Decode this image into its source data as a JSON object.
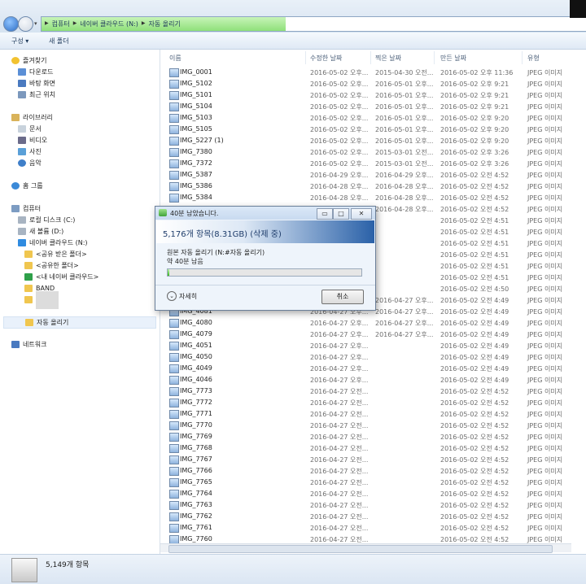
{
  "address": {
    "crumbs": [
      "컴퓨터",
      "네이버 클라우드 (N:)",
      "자동 올리기"
    ]
  },
  "toolbar": {
    "organize": "구성 ▾",
    "new_folder": "새 폴더"
  },
  "nav": {
    "favorites": "즐겨찾기",
    "downloads": "다운로드",
    "desktop": "바탕 화면",
    "recent": "최근 위치",
    "libraries": "라이브러리",
    "documents": "문서",
    "videos": "비디오",
    "pictures": "사진",
    "music": "음악",
    "homegroup": "홈 그룹",
    "computer": "컴퓨터",
    "local_disk": "로컬 디스크 (C:)",
    "new_volume": "새 볼륨 (D:)",
    "naver_cloud": "네이버 클라우드 (N:)",
    "shared_received": "<공유 받은 폴더>",
    "shared_folder": "<공유한 폴더>",
    "my_cloud": "<내 네이버 클라우드>",
    "band": "BAND",
    "auto_upload": "자동 올리기",
    "network": "네트워크"
  },
  "columns": [
    "이름",
    "수정한 날짜",
    "찍은 날짜",
    "만든 날짜",
    "유형"
  ],
  "files": [
    {
      "name": "IMG_0001",
      "modified": "2016-05-02 오후...",
      "taken": "2015-04-30 오전...",
      "created": "2016-05-02 오후 11:36",
      "type": "JPEG 이미지"
    },
    {
      "name": "IMG_5102",
      "modified": "2016-05-02 오후...",
      "taken": "2016-05-01 오후...",
      "created": "2016-05-02 오후 9:21",
      "type": "JPEG 이미지"
    },
    {
      "name": "IMG_5101",
      "modified": "2016-05-02 오후...",
      "taken": "2016-05-01 오후...",
      "created": "2016-05-02 오후 9:21",
      "type": "JPEG 이미지"
    },
    {
      "name": "IMG_5104",
      "modified": "2016-05-02 오후...",
      "taken": "2016-05-01 오후...",
      "created": "2016-05-02 오후 9:21",
      "type": "JPEG 이미지"
    },
    {
      "name": "IMG_5103",
      "modified": "2016-05-02 오후...",
      "taken": "2016-05-01 오후...",
      "created": "2016-05-02 오후 9:20",
      "type": "JPEG 이미지"
    },
    {
      "name": "IMG_5105",
      "modified": "2016-05-02 오후...",
      "taken": "2016-05-01 오후...",
      "created": "2016-05-02 오후 9:20",
      "type": "JPEG 이미지"
    },
    {
      "name": "IMG_5227 (1)",
      "modified": "2016-05-02 오후...",
      "taken": "2016-05-01 오후...",
      "created": "2016-05-02 오후 9:20",
      "type": "JPEG 이미지"
    },
    {
      "name": "IMG_7380",
      "modified": "2016-05-02 오후...",
      "taken": "2015-03-01 오전...",
      "created": "2016-05-02 오후 3:26",
      "type": "JPEG 이미지"
    },
    {
      "name": "IMG_7372",
      "modified": "2016-05-02 오후...",
      "taken": "2015-03-01 오전...",
      "created": "2016-05-02 오후 3:26",
      "type": "JPEG 이미지"
    },
    {
      "name": "IMG_5387",
      "modified": "2016-04-29 오후...",
      "taken": "2016-04-29 오후...",
      "created": "2016-05-02 오전 4:52",
      "type": "JPEG 이미지"
    },
    {
      "name": "IMG_5386",
      "modified": "2016-04-28 오후...",
      "taken": "2016-04-28 오후...",
      "created": "2016-05-02 오전 4:52",
      "type": "JPEG 이미지"
    },
    {
      "name": "IMG_5384",
      "modified": "2016-04-28 오후...",
      "taken": "2016-04-28 오후...",
      "created": "2016-05-02 오전 4:52",
      "type": "JPEG 이미지"
    },
    {
      "name": "",
      "modified": "",
      "taken": "2016-04-28 오후...",
      "created": "2016-05-02 오전 4:52",
      "type": "JPEG 이미지"
    },
    {
      "name": "",
      "modified": "",
      "taken": "",
      "created": "2016-05-02 오전 4:51",
      "type": "JPEG 이미지"
    },
    {
      "name": "",
      "modified": "",
      "taken": "",
      "created": "2016-05-02 오전 4:51",
      "type": "JPEG 이미지"
    },
    {
      "name": "",
      "modified": "",
      "taken": "",
      "created": "2016-05-02 오전 4:51",
      "type": "JPEG 이미지"
    },
    {
      "name": "",
      "modified": "",
      "taken": "",
      "created": "2016-05-02 오전 4:51",
      "type": "JPEG 이미지"
    },
    {
      "name": "",
      "modified": "",
      "taken": "",
      "created": "2016-05-02 오전 4:51",
      "type": "JPEG 이미지"
    },
    {
      "name": "",
      "modified": "",
      "taken": "",
      "created": "2016-05-02 오전 4:51",
      "type": "JPEG 이미지"
    },
    {
      "name": "",
      "modified": "",
      "taken": "",
      "created": "2016-05-02 오전 4:50",
      "type": "JPEG 이미지"
    },
    {
      "name": "",
      "modified": "",
      "taken": "2016-04-27 오후...",
      "created": "2016-05-02 오전 4:49",
      "type": "JPEG 이미지"
    },
    {
      "name": "IMG_4081",
      "modified": "2016-04-27 오후...",
      "taken": "2016-04-27 오후...",
      "created": "2016-05-02 오전 4:49",
      "type": "JPEG 이미지"
    },
    {
      "name": "IMG_4080",
      "modified": "2016-04-27 오후...",
      "taken": "2016-04-27 오후...",
      "created": "2016-05-02 오전 4:49",
      "type": "JPEG 이미지"
    },
    {
      "name": "IMG_4079",
      "modified": "2016-04-27 오후...",
      "taken": "2016-04-27 오후...",
      "created": "2016-05-02 오전 4:49",
      "type": "JPEG 이미지"
    },
    {
      "name": "IMG_4051",
      "modified": "2016-04-27 오후...",
      "taken": "",
      "created": "2016-05-02 오전 4:49",
      "type": "JPEG 이미지"
    },
    {
      "name": "IMG_4050",
      "modified": "2016-04-27 오후...",
      "taken": "",
      "created": "2016-05-02 오전 4:49",
      "type": "JPEG 이미지"
    },
    {
      "name": "IMG_4049",
      "modified": "2016-04-27 오후...",
      "taken": "",
      "created": "2016-05-02 오전 4:49",
      "type": "JPEG 이미지"
    },
    {
      "name": "IMG_4046",
      "modified": "2016-04-27 오후...",
      "taken": "",
      "created": "2016-05-02 오전 4:49",
      "type": "JPEG 이미지"
    },
    {
      "name": "IMG_7773",
      "modified": "2016-04-27 오전...",
      "taken": "",
      "created": "2016-05-02 오전 4:52",
      "type": "JPEG 이미지"
    },
    {
      "name": "IMG_7772",
      "modified": "2016-04-27 오전...",
      "taken": "",
      "created": "2016-05-02 오전 4:52",
      "type": "JPEG 이미지"
    },
    {
      "name": "IMG_7771",
      "modified": "2016-04-27 오전...",
      "taken": "",
      "created": "2016-05-02 오전 4:52",
      "type": "JPEG 이미지"
    },
    {
      "name": "IMG_7770",
      "modified": "2016-04-27 오전...",
      "taken": "",
      "created": "2016-05-02 오전 4:52",
      "type": "JPEG 이미지"
    },
    {
      "name": "IMG_7769",
      "modified": "2016-04-27 오전...",
      "taken": "",
      "created": "2016-05-02 오전 4:52",
      "type": "JPEG 이미지"
    },
    {
      "name": "IMG_7768",
      "modified": "2016-04-27 오전...",
      "taken": "",
      "created": "2016-05-02 오전 4:52",
      "type": "JPEG 이미지"
    },
    {
      "name": "IMG_7767",
      "modified": "2016-04-27 오전...",
      "taken": "",
      "created": "2016-05-02 오전 4:52",
      "type": "JPEG 이미지"
    },
    {
      "name": "IMG_7766",
      "modified": "2016-04-27 오전...",
      "taken": "",
      "created": "2016-05-02 오전 4:52",
      "type": "JPEG 이미지"
    },
    {
      "name": "IMG_7765",
      "modified": "2016-04-27 오전...",
      "taken": "",
      "created": "2016-05-02 오전 4:52",
      "type": "JPEG 이미지"
    },
    {
      "name": "IMG_7764",
      "modified": "2016-04-27 오전...",
      "taken": "",
      "created": "2016-05-02 오전 4:52",
      "type": "JPEG 이미지"
    },
    {
      "name": "IMG_7763",
      "modified": "2016-04-27 오전...",
      "taken": "",
      "created": "2016-05-02 오전 4:52",
      "type": "JPEG 이미지"
    },
    {
      "name": "IMG_7762",
      "modified": "2016-04-27 오전...",
      "taken": "",
      "created": "2016-05-02 오전 4:52",
      "type": "JPEG 이미지"
    },
    {
      "name": "IMG_7761",
      "modified": "2016-04-27 오전...",
      "taken": "",
      "created": "2016-05-02 오전 4:52",
      "type": "JPEG 이미지"
    },
    {
      "name": "IMG_7760",
      "modified": "2016-04-27 오전...",
      "taken": "",
      "created": "2016-05-02 오전 4:52",
      "type": "JPEG 이미지"
    }
  ],
  "status": {
    "items": "5,149개 항목"
  },
  "dialog": {
    "title": "40분 남았습니다.",
    "minimize": "▭",
    "maximize": "□",
    "close": "✕",
    "heading": "5,176개 항목(8.31GB) (삭제 중)",
    "source": "원본 자동 올리기 (N:#자동 올리기)",
    "remaining": "약 40분 남음",
    "progress": 0.01,
    "details": "자세히",
    "cancel": "취소"
  },
  "colors": {
    "progress": "#37b521",
    "address_fill": "#8fe07a",
    "banner": "#2a61a8"
  }
}
